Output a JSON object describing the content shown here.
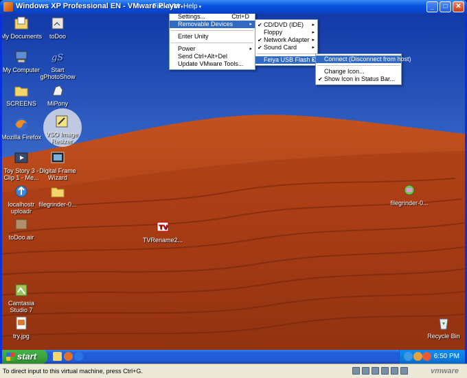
{
  "window": {
    "title": "Windows XP Professional EN - VMware Player",
    "menus": [
      {
        "label": "File",
        "arrow": "▾"
      },
      {
        "label": "VM",
        "arrow": "▾"
      },
      {
        "label": "Help",
        "arrow": "▾"
      }
    ],
    "buttons": {
      "minimize": "_",
      "maximize": "□",
      "close": "✕"
    }
  },
  "vm_menu": {
    "items": [
      {
        "label": "Settings...",
        "shortcut": "Ctrl+D"
      },
      {
        "label": "Removable Devices",
        "submenu": "▸"
      },
      {
        "label": "Enter Unity"
      },
      {
        "label": "Power",
        "submenu": "▸"
      },
      {
        "label": "Send Ctrl+Alt+Del"
      },
      {
        "label": "Update VMware Tools..."
      }
    ]
  },
  "devices_menu": {
    "items": [
      {
        "label": "CD/DVD (IDE)",
        "check": "✔",
        "submenu": "▸"
      },
      {
        "label": "Floppy",
        "check": "",
        "submenu": "▸"
      },
      {
        "label": "Network Adapter",
        "check": "✔",
        "submenu": "▸"
      },
      {
        "label": "Sound Card",
        "check": "✔",
        "submenu": "▸"
      },
      {
        "label": "Feiya USB Flash Disk",
        "check": "",
        "submenu": "▸"
      }
    ]
  },
  "usb_menu": {
    "items": [
      {
        "label": "Connect (Disconnect from host)",
        "check": ""
      },
      {
        "label": "Change Icon...",
        "check": ""
      },
      {
        "label": "Show Icon in Status Bar...",
        "check": "✔"
      }
    ]
  },
  "desktop": {
    "icons": [
      {
        "label": "My Documents",
        "icon": "folder-docs-icon"
      },
      {
        "label": "toDoo",
        "icon": "shortcut-icon"
      },
      {
        "label": "My Computer",
        "icon": "computer-icon"
      },
      {
        "label": "Start gPhotoShow",
        "icon": "photoshow-icon"
      },
      {
        "label": "SCREENS",
        "icon": "folder-icon"
      },
      {
        "label": "MiPony",
        "icon": "mipony-icon"
      },
      {
        "label": "Mozilla Firefox",
        "icon": "firefox-icon"
      },
      {
        "label": "VSO Image Resizer",
        "icon": "resizer-icon"
      },
      {
        "label": "Toy Story 3 - Clip 1 - Me...",
        "icon": "video-icon"
      },
      {
        "label": "Digital Frame Wizard",
        "icon": "frame-icon"
      },
      {
        "label": "localhostr uploadr",
        "icon": "uploadr-icon"
      },
      {
        "label": "filegrinder-0...",
        "icon": "folder-icon"
      },
      {
        "label": "toDoo.air",
        "icon": "air-icon"
      },
      {
        "label": "TVRename2...",
        "icon": "tvrename-icon"
      },
      {
        "label": "Camtasia Studio 7",
        "icon": "camtasia-icon"
      },
      {
        "label": "try.jpg",
        "icon": "image-file-icon"
      },
      {
        "label": "filegrinder-0...",
        "icon": "filegrinder-icon"
      },
      {
        "label": "Recycle Bin",
        "icon": "recycle-bin-icon"
      }
    ]
  },
  "taskbar": {
    "start_label": "start",
    "clock": "6:50 PM"
  },
  "statusbar": {
    "hint": "To direct input to this virtual machine, press Ctrl+G.",
    "logo": "vmware"
  },
  "colors": {
    "selection": "#316ac5",
    "xp_blue": "#0831d9",
    "start_green": "#38a13a"
  }
}
